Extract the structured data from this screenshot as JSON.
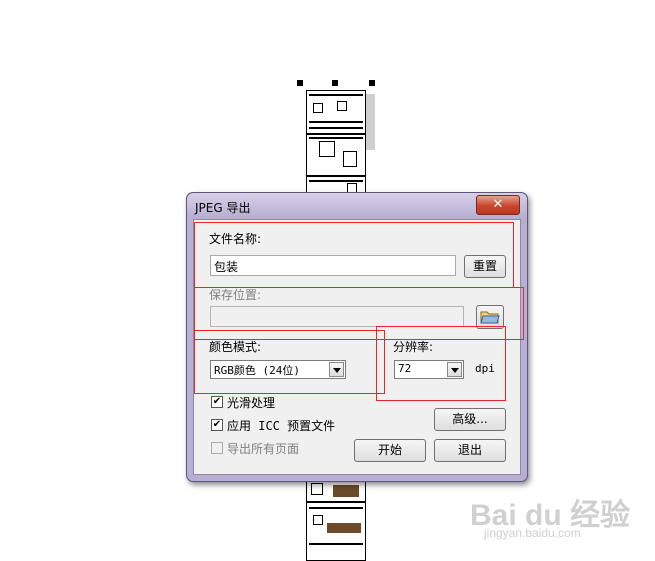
{
  "dialog": {
    "title": "JPEG 导出",
    "close_symbol": "✕",
    "filename": {
      "label": "文件名称:",
      "value": "包装",
      "reset_button": "重置"
    },
    "save_location": {
      "label": "保存位置:",
      "value": ""
    },
    "color_mode": {
      "label": "颜色模式:",
      "value": "RGB颜色 (24位)"
    },
    "resolution": {
      "label": "分辨率:",
      "value": "72",
      "unit": "dpi"
    },
    "options": [
      {
        "label": "光滑处理",
        "checked": true,
        "enabled": true
      },
      {
        "label": "应用 ICC 预置文件",
        "checked": true,
        "enabled": true
      },
      {
        "label": "导出所有页面",
        "checked": false,
        "enabled": false
      }
    ],
    "advanced_button": "高级...",
    "start_button": "开始",
    "exit_button": "退出"
  },
  "watermark": {
    "text": "Bai du 经验",
    "sub": "jingyan.baidu.com"
  },
  "colors": {
    "highlight": "#e8262b",
    "dialog_frame": "#b8b0d2"
  }
}
